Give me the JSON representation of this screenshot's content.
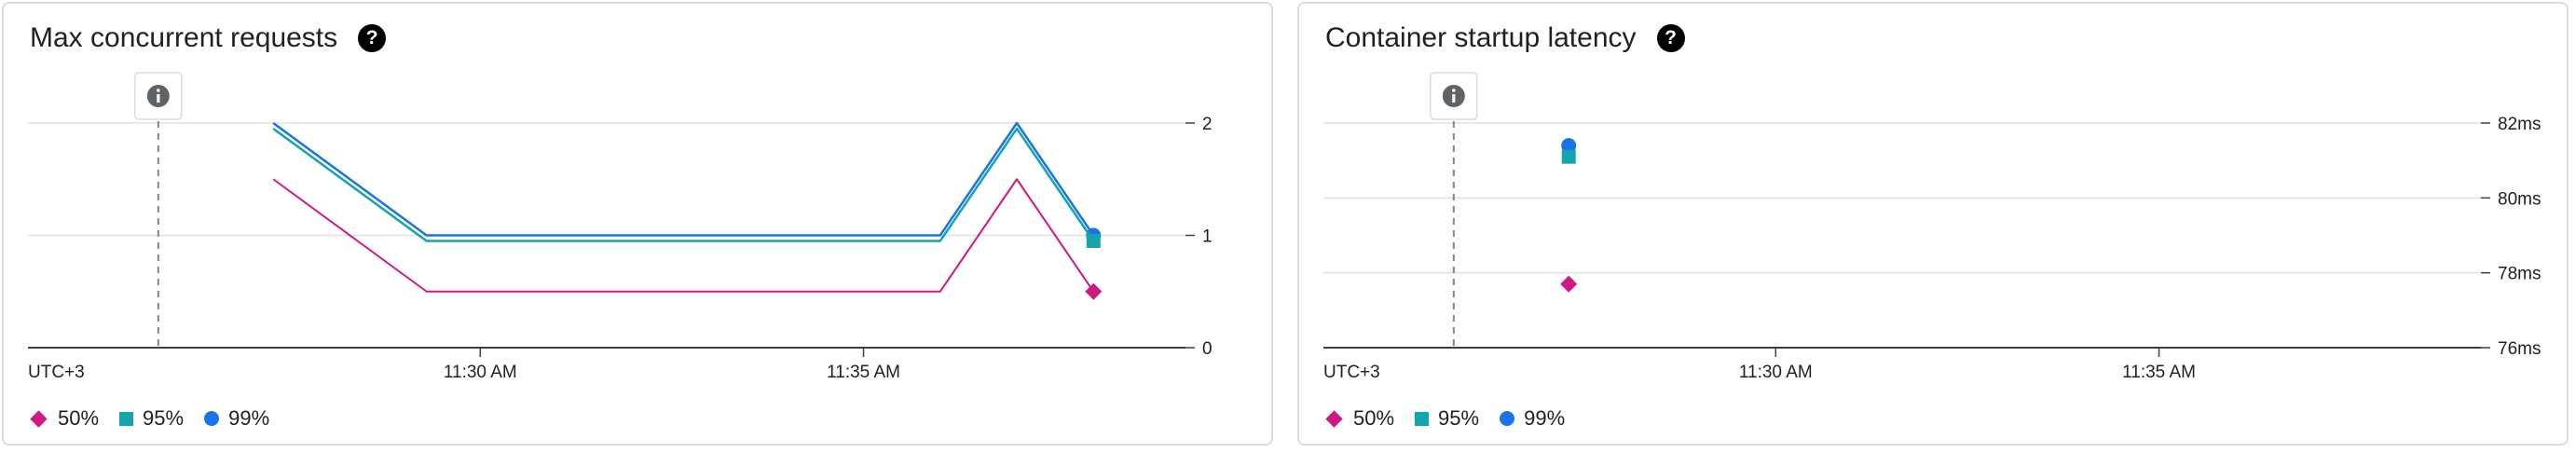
{
  "colors": {
    "p50": "#d01884",
    "p95": "#12a4af",
    "p99": "#1a73e8",
    "grid": "#e0e0e0",
    "axis": "#3c4043",
    "marker_line": "#80868b"
  },
  "panels": [
    {
      "title": "Max concurrent requests",
      "help_icon": "help-icon",
      "info_icon": "info-icon"
    },
    {
      "title": "Container startup latency",
      "help_icon": "help-icon",
      "info_icon": "info-icon"
    }
  ],
  "legend": [
    {
      "label": "50%",
      "marker": "diamond",
      "color": "#d01884"
    },
    {
      "label": "95%",
      "marker": "square",
      "color": "#12a4af"
    },
    {
      "label": "99%",
      "marker": "circle",
      "color": "#1a73e8"
    }
  ],
  "chart_data": [
    {
      "type": "line",
      "title": "Max concurrent requests",
      "timezone_label": "UTC+3",
      "x_tick_labels": [
        "11:30 AM",
        "11:35 AM"
      ],
      "x_tick_minutes": [
        30,
        35
      ],
      "xlim": [
        24.1,
        39.2
      ],
      "y_tick_labels": [
        "0",
        "1",
        "2"
      ],
      "y_ticks": [
        0,
        1,
        2
      ],
      "ylim": [
        0,
        2
      ],
      "annotation_minute": 25.8,
      "series": [
        {
          "name": "99%",
          "color": "#1a73e8",
          "marker": "circle",
          "x": [
            27.3,
            29.3,
            36.0,
            37.0,
            38.0
          ],
          "y": [
            2.0,
            1.0,
            1.0,
            2.0,
            1.0
          ]
        },
        {
          "name": "95%",
          "color": "#12a4af",
          "marker": "square",
          "x": [
            27.3,
            29.3,
            36.0,
            37.0,
            38.0
          ],
          "y": [
            1.95,
            0.95,
            0.95,
            1.95,
            0.95
          ]
        },
        {
          "name": "50%",
          "color": "#d01884",
          "marker": "diamond",
          "x": [
            27.3,
            29.3,
            36.0,
            37.0,
            38.0
          ],
          "y": [
            1.5,
            0.5,
            0.5,
            1.5,
            0.5
          ]
        }
      ]
    },
    {
      "type": "scatter",
      "title": "Container startup latency",
      "timezone_label": "UTC+3",
      "x_tick_labels": [
        "11:30 AM",
        "11:35 AM"
      ],
      "x_tick_minutes": [
        30,
        35
      ],
      "xlim": [
        24.1,
        39.2
      ],
      "y_tick_labels": [
        "76ms",
        "78ms",
        "80ms",
        "82ms"
      ],
      "y_ticks": [
        76,
        78,
        80,
        82
      ],
      "ylim": [
        76,
        82
      ],
      "annotation_minute": 25.8,
      "series": [
        {
          "name": "99%",
          "color": "#1a73e8",
          "marker": "circle",
          "x": [
            27.3
          ],
          "y": [
            81.4
          ]
        },
        {
          "name": "95%",
          "color": "#12a4af",
          "marker": "square",
          "x": [
            27.3
          ],
          "y": [
            81.1
          ]
        },
        {
          "name": "50%",
          "color": "#d01884",
          "marker": "diamond",
          "x": [
            27.3
          ],
          "y": [
            77.7
          ]
        }
      ]
    }
  ]
}
